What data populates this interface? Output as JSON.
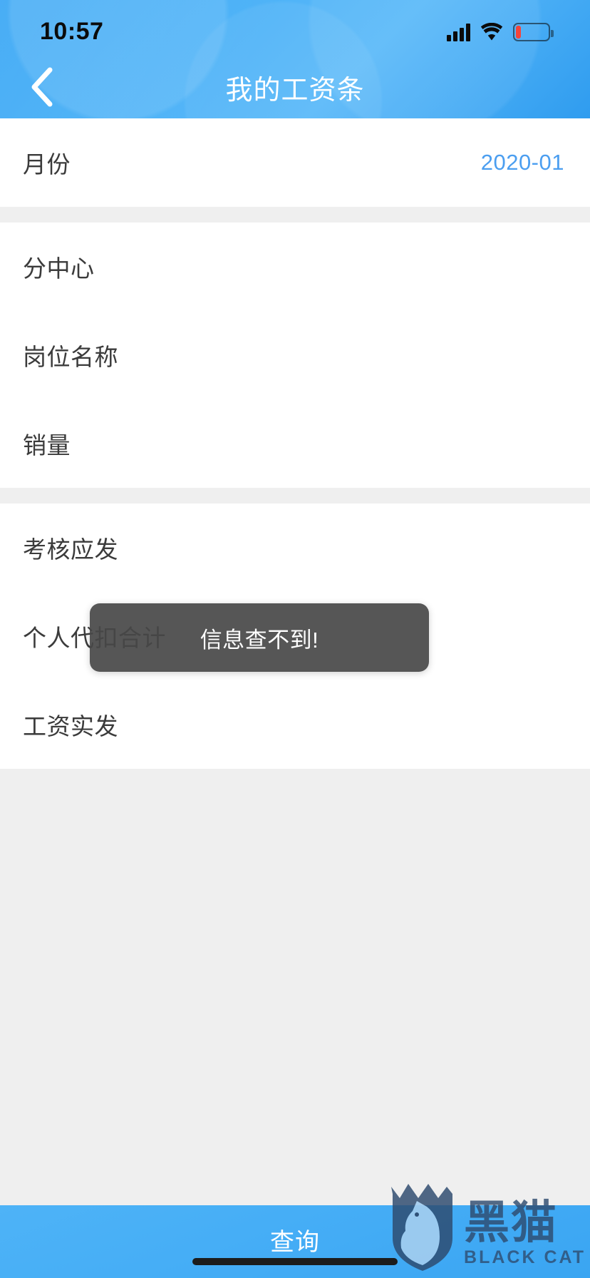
{
  "statusbar": {
    "time": "10:57",
    "signal_icon": "signal-bars-icon",
    "wifi_icon": "wifi-icon",
    "battery_icon": "battery-low-icon"
  },
  "header": {
    "back_icon": "chevron-left-icon",
    "title": "我的工资条",
    "accent_color": "#4db2f7"
  },
  "sections": [
    {
      "rows": [
        {
          "label": "月份",
          "value": "2020-01",
          "value_color": "#4b9ef0"
        }
      ]
    },
    {
      "rows": [
        {
          "label": "分中心",
          "value": ""
        },
        {
          "label": "岗位名称",
          "value": ""
        },
        {
          "label": "销量",
          "value": ""
        }
      ]
    },
    {
      "rows": [
        {
          "label": "考核应发",
          "value": ""
        },
        {
          "label": "个人代扣合计",
          "value": ""
        },
        {
          "label": "工资实发",
          "value": ""
        }
      ]
    }
  ],
  "toast": {
    "message": "信息查不到!",
    "background_color": "#484848",
    "text_color": "#ffffff"
  },
  "footer": {
    "query_label": "查询",
    "background_color": "#46aef6"
  },
  "watermark": {
    "cn": "黑猫",
    "en": "BLACK CAT",
    "shield_icon": "black-cat-shield-icon",
    "color": "#2e4a6e"
  }
}
